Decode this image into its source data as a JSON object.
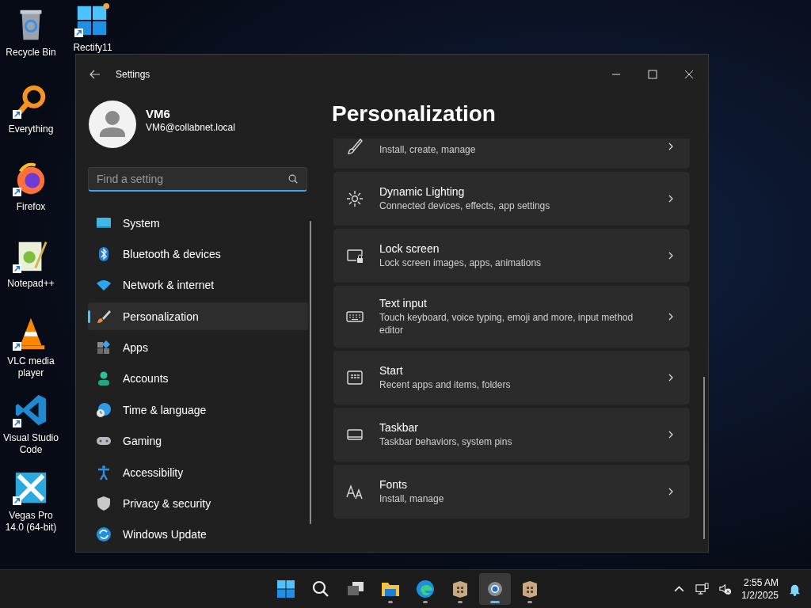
{
  "desktop_icons": [
    {
      "label": "Recycle Bin"
    },
    {
      "label": "Rectify11"
    },
    {
      "label": "Everything"
    },
    {
      "label": "Firefox"
    },
    {
      "label": "Notepad++"
    },
    {
      "label": "VLC media player"
    },
    {
      "label": "Visual Studio Code"
    },
    {
      "label": "Vegas Pro 14.0 (64-bit)"
    }
  ],
  "window": {
    "title": "Settings"
  },
  "profile": {
    "name": "VM6",
    "email": "VM6@collabnet.local"
  },
  "search": {
    "placeholder": "Find a setting"
  },
  "nav_items": [
    {
      "label": "System",
      "selected": false
    },
    {
      "label": "Bluetooth & devices",
      "selected": false
    },
    {
      "label": "Network & internet",
      "selected": false
    },
    {
      "label": "Personalization",
      "selected": true
    },
    {
      "label": "Apps",
      "selected": false
    },
    {
      "label": "Accounts",
      "selected": false
    },
    {
      "label": "Time & language",
      "selected": false
    },
    {
      "label": "Gaming",
      "selected": false
    },
    {
      "label": "Accessibility",
      "selected": false
    },
    {
      "label": "Privacy & security",
      "selected": false
    },
    {
      "label": "Windows Update",
      "selected": false
    }
  ],
  "page_title": "Personalization",
  "cards": [
    {
      "description": "Install, create, manage"
    },
    {
      "title": "Dynamic Lighting",
      "description": "Connected devices, effects, app settings"
    },
    {
      "title": "Lock screen",
      "description": "Lock screen images, apps, animations"
    },
    {
      "title": "Text input",
      "description": "Touch keyboard, voice typing, emoji and more, input method editor"
    },
    {
      "title": "Start",
      "description": "Recent apps and items, folders"
    },
    {
      "title": "Taskbar",
      "description": "Taskbar behaviors, system pins"
    },
    {
      "title": "Fonts",
      "description": "Install, manage"
    }
  ],
  "taskbar_apps": [
    {
      "active": false,
      "running": false
    },
    {
      "active": false,
      "running": false
    },
    {
      "active": false,
      "running": false
    },
    {
      "active": false,
      "running": true
    },
    {
      "active": false,
      "running": true
    },
    {
      "active": false,
      "running": true
    },
    {
      "active": true,
      "running": true
    },
    {
      "active": false,
      "running": true
    }
  ],
  "clock": {
    "time": "2:55 AM",
    "date": "1/2/2025"
  }
}
